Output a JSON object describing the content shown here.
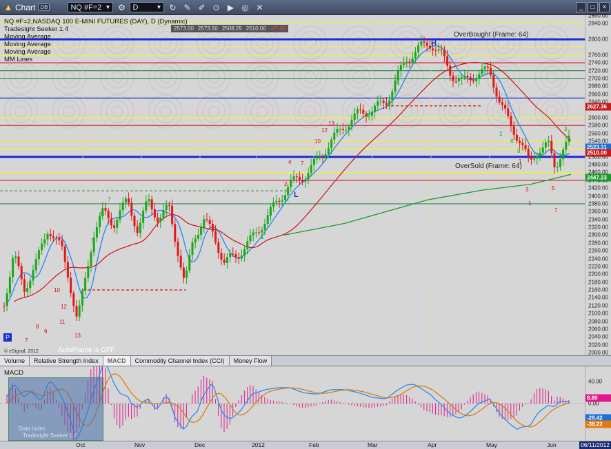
{
  "window": {
    "title": "Chart",
    "badge": "DB",
    "symbol": "NQ #F=2",
    "interval": "D",
    "buttons": [
      "zoom",
      "draw",
      "text",
      "erase",
      "play",
      "settings",
      "tools"
    ]
  },
  "chart": {
    "header": "NQ #F=2,NASDAQ 100 E-MINI FUTURES (DAY), D (Dynamic)",
    "studies": [
      "Tradesight Seeker 1.4",
      "Moving Average",
      "Moving Average",
      "Moving Average",
      "MM Lines"
    ],
    "quote": [
      "2573.00",
      "2573.50",
      "2508.25",
      "2510.00",
      "-47.00"
    ],
    "overbought_label": "OverBought (Frame: 64)",
    "oversold_label": "OverSold (Frame: 64)",
    "autoframe_label": "AutoFrame is OFF",
    "copyright": "© eSignal, 2012",
    "p_marker": "P",
    "high_marker": "H",
    "low_marker": "L",
    "y_ticks": [
      "2860.00",
      "2840.00",
      "2800.00",
      "2760.00",
      "2740.00",
      "2720.00",
      "2700.00",
      "2680.00",
      "2660.00",
      "2640.00",
      "2600.00",
      "2580.00",
      "2560.00",
      "2540.00",
      "2520.00",
      "2500.00",
      "2480.00",
      "2460.00",
      "2440.00",
      "2420.00",
      "2400.00",
      "2380.00",
      "2360.00",
      "2340.00",
      "2320.00",
      "2300.00",
      "2280.00",
      "2260.00",
      "2240.00",
      "2220.00",
      "2200.00",
      "2180.00",
      "2160.00",
      "2140.00",
      "2120.00",
      "2100.00",
      "2080.00",
      "2060.00",
      "2040.00",
      "2020.00",
      "2000.00"
    ],
    "price_tags": [
      {
        "value": "2627.36",
        "color": "#c41b1b"
      },
      {
        "value": "2523.31",
        "color": "#1e6fd6"
      },
      {
        "value": "2510.00",
        "color": "#c41b1b"
      },
      {
        "value": "2447.23",
        "color": "#1b9a2b"
      }
    ],
    "colors": {
      "up": "#18a818",
      "down": "#e11818",
      "ma_fast": "#2a8cf0",
      "ma_mid": "#d01010",
      "ma_slow": "#1b9a2b",
      "mm_blue": "#1a2ad0",
      "mm_yellow": "#f0f040",
      "mm_red": "#d01010",
      "mm_green": "#2e8b57"
    }
  },
  "tabs": [
    {
      "label": "Volume",
      "active": false
    },
    {
      "label": "Relative Strength Index",
      "active": false
    },
    {
      "label": "MACD",
      "active": true
    },
    {
      "label": "Commodity Channel Index (CCI)",
      "active": false
    },
    {
      "label": "Money Flow",
      "active": false
    }
  ],
  "macd": {
    "title": "MACD",
    "y_ticks": [
      "40.00",
      "0.00",
      "-40.00"
    ],
    "tags": [
      {
        "value": "8.80",
        "color": "#e0188a"
      },
      {
        "value": "-29.42",
        "color": "#1e6fd6"
      },
      {
        "value": "-38.22",
        "color": "#e07a10"
      }
    ],
    "overlay_label": "Tradesight Seeker 1.4",
    "overlay_sub": "Data Index"
  },
  "xaxis": {
    "labels": [
      "Oct",
      "Nov",
      "Dec",
      "2012",
      "Feb",
      "Mar",
      "Apr",
      "May",
      "Jun"
    ],
    "current_date": "06/11/2012"
  }
}
